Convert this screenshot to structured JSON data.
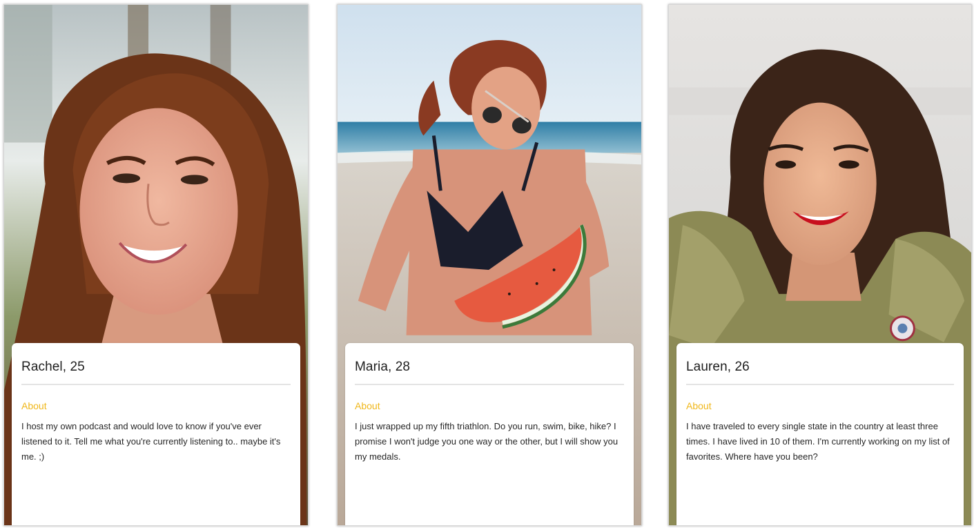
{
  "profiles": [
    {
      "name_age": "Rachel, 25",
      "section_label": "About",
      "bio": "I host my own podcast and would love to know if you've ever listened to it. Tell me what you're currently listening to.. maybe it's me. ;)"
    },
    {
      "name_age": "Maria, 28",
      "section_label": "About",
      "bio": "I just wrapped up my fifth triathlon. Do you run, swim, bike, hike? I promise I won't judge you one way or the other, but I will show you my medals."
    },
    {
      "name_age": "Lauren, 26",
      "section_label": "About",
      "bio": "I have traveled to every single state in the country at least three times. I have lived in 10 of them. I'm currently working on my list of favorites. Where have you been?"
    }
  ],
  "colors": {
    "accent": "#f0b71a",
    "card_bg": "#ffffff",
    "text": "#1e1e1e"
  }
}
